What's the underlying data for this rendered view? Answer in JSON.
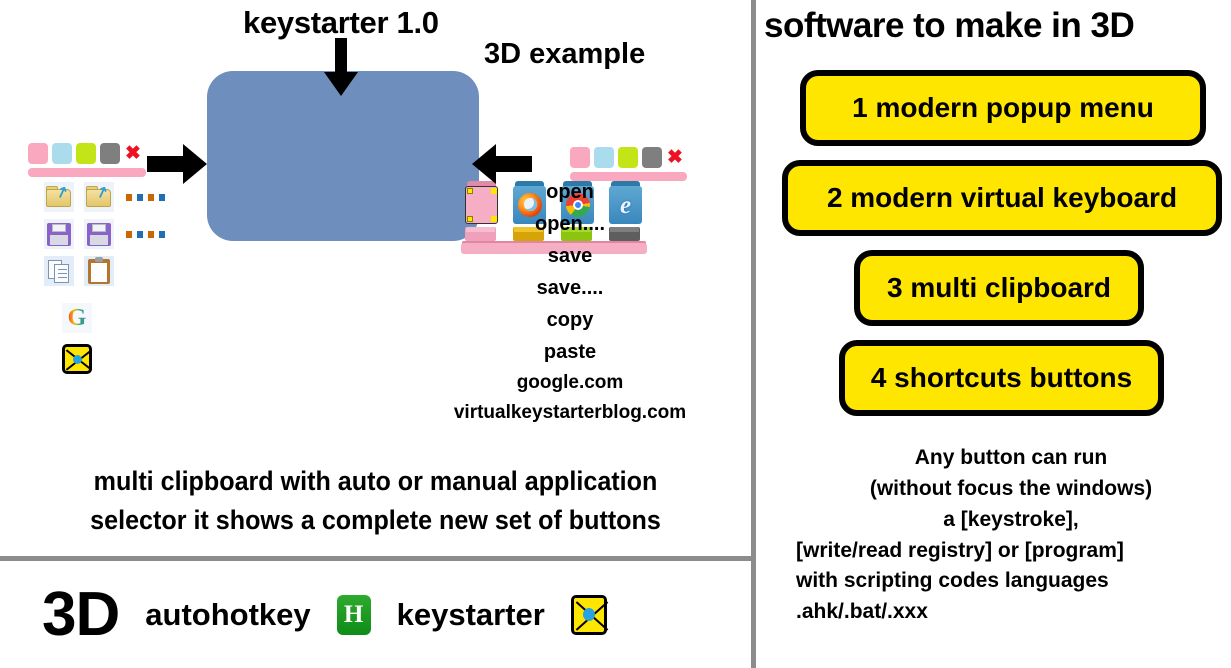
{
  "left": {
    "title": "keystarter 1.0",
    "example_label": "3D example",
    "caption_line1": "multi clipboard with auto or manual application",
    "caption_line2": "selector it shows a complete new set of buttons",
    "menu_items": [
      "open",
      "open....",
      "save",
      "save....",
      "copy",
      "paste",
      "google.com",
      "virtualkeystarterblog.com"
    ],
    "palette_colors": {
      "pink": "#f9a8c0",
      "light_blue": "#aadcee",
      "lime": "#c3e416",
      "gray": "#7f7f7f",
      "close_x": "#ee1122",
      "bar": "#f9a8c0"
    },
    "card_color": "#6e8ebd",
    "icons": {
      "open_folder": "folder-open-icon",
      "save_floppy": "floppy-disk-icon",
      "copy": "copy-icon",
      "paste": "clipboard-paste-icon",
      "google": "google-g-icon",
      "keystarter": "keystarter-icon",
      "google_letter": "G"
    },
    "mockup": {
      "cube_labels": [
        "blank",
        "firefox",
        "chrome",
        "internet-explorer"
      ],
      "ie_glyph": "e",
      "box_colors": [
        "#f6aec5",
        "#e8b616",
        "#9cd41a",
        "#6e6e6e"
      ]
    }
  },
  "footer": {
    "badge_3d": "3D",
    "autohotkey_label": "autohotkey",
    "autohotkey_glyph": "H",
    "keystarter_label": "keystarter"
  },
  "right": {
    "title": "software to make in 3D",
    "buttons": [
      "1 modern popup menu",
      "2 modern virtual keyboard",
      "3 multi clipboard",
      "4 shortcuts buttons"
    ],
    "button_color": "#ffe600",
    "note_lines": [
      "Any button can run",
      "(without focus the windows)",
      "a [keystroke],",
      "[write/read registry] or [program]",
      "with scripting codes languages",
      ".ahk/.bat/.xxx"
    ]
  }
}
